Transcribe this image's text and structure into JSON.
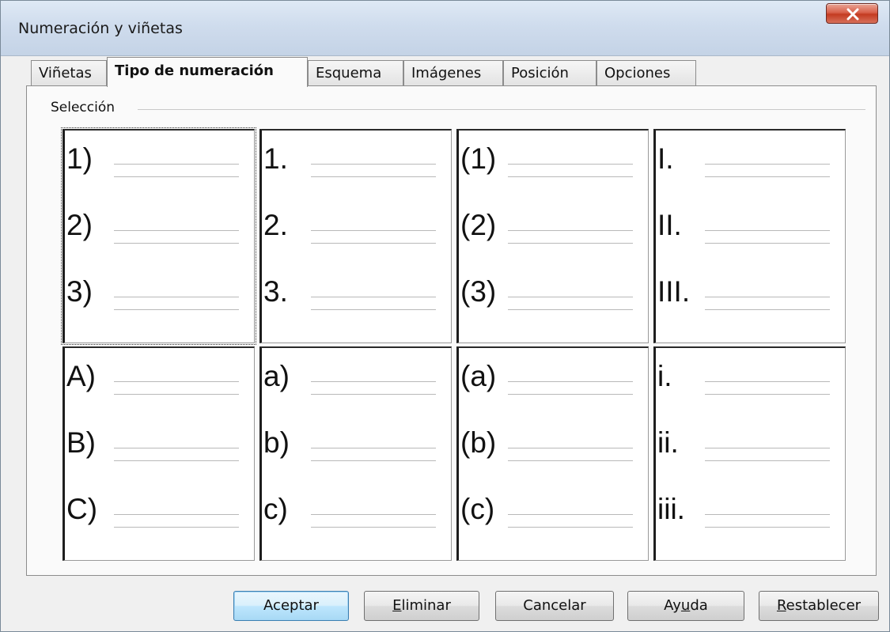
{
  "window": {
    "title": "Numeración y viñetas",
    "close_icon": "close-icon"
  },
  "tabs": [
    {
      "label": "Viñetas",
      "active": false
    },
    {
      "label": "Tipo de numeración",
      "active": true
    },
    {
      "label": "Esquema",
      "active": false
    },
    {
      "label": "Imágenes",
      "active": false
    },
    {
      "label": "Posición",
      "active": false
    },
    {
      "label": "Opciones",
      "active": false
    }
  ],
  "selection": {
    "label": "Selección",
    "cells": [
      {
        "items": [
          "1)",
          "2)",
          "3)"
        ],
        "selected": true
      },
      {
        "items": [
          "1.",
          "2.",
          "3."
        ],
        "selected": false
      },
      {
        "items": [
          "(1)",
          "(2)",
          "(3)"
        ],
        "selected": false
      },
      {
        "items": [
          "I.",
          "II.",
          "III."
        ],
        "selected": false
      },
      {
        "items": [
          "A)",
          "B)",
          "C)"
        ],
        "selected": false
      },
      {
        "items": [
          "a)",
          "b)",
          "c)"
        ],
        "selected": false
      },
      {
        "items": [
          "(a)",
          "(b)",
          "(c)"
        ],
        "selected": false
      },
      {
        "items": [
          "i.",
          "ii.",
          "iii."
        ],
        "selected": false
      }
    ]
  },
  "buttons": {
    "ok": "Aceptar",
    "delete_pre": "",
    "delete_key": "E",
    "delete_post": "liminar",
    "cancel": "Cancelar",
    "help_pre": "Ay",
    "help_key": "u",
    "help_post": "da",
    "reset_pre": "",
    "reset_key": "R",
    "reset_post": "establecer"
  }
}
